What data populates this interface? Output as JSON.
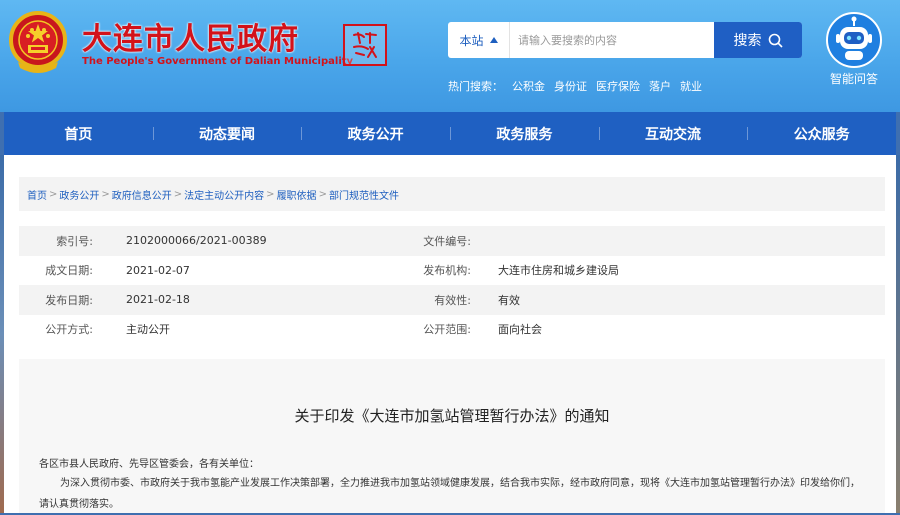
{
  "header": {
    "title_cn": "大连市人民政府",
    "title_en": "The People's Government of Dalian Municipality",
    "emblem_icon": "national-emblem-icon",
    "seal_icon": "calligraphy-seal-icon"
  },
  "search": {
    "scope_label": "本站",
    "placeholder": "请输入要搜索的内容",
    "button_label": "搜索",
    "hot_label": "热门搜索：",
    "hot_keywords": [
      "公积金",
      "身份证",
      "医疗保险",
      "落户",
      "就业"
    ]
  },
  "assistant": {
    "label": "智能问答",
    "icon": "robot-icon"
  },
  "nav": {
    "items": [
      "首页",
      "动态要闻",
      "政务公开",
      "政务服务",
      "互动交流",
      "公众服务"
    ]
  },
  "breadcrumb": [
    "首页",
    "政务公开",
    "政府信息公开",
    "法定主动公开内容",
    "履职依据",
    "部门规范性文件"
  ],
  "meta": {
    "rows": [
      {
        "label1": "索引号:",
        "value1": "2102000066/2021-00389",
        "label2": "文件编号:",
        "value2": ""
      },
      {
        "label1": "成文日期:",
        "value1": "2021-02-07",
        "label2": "发布机构:",
        "value2": "大连市住房和城乡建设局"
      },
      {
        "label1": "发布日期:",
        "value1": "2021-02-18",
        "label2": "有效性:",
        "value2": "有效"
      },
      {
        "label1": "公开方式:",
        "value1": "主动公开",
        "label2": "公开范围:",
        "value2": "面向社会"
      }
    ]
  },
  "article": {
    "title": "关于印发《大连市加氢站管理暂行办法》的通知",
    "salutation": "各区市县人民政府、先导区管委会，各有关单位：",
    "body": "为深入贯彻市委、市政府关于我市氢能产业发展工作决策部署，全力推进我市加氢站领域健康发展，结合我市实际，经市政府同意，现将《大连市加氢站管理暂行办法》印发给你们，请认真贯彻落实。"
  },
  "colors": {
    "header_blue": "#4aa6ea",
    "nav_blue": "#1f60c2",
    "title_red": "#d3121a",
    "link_blue": "#1e5fbf"
  }
}
